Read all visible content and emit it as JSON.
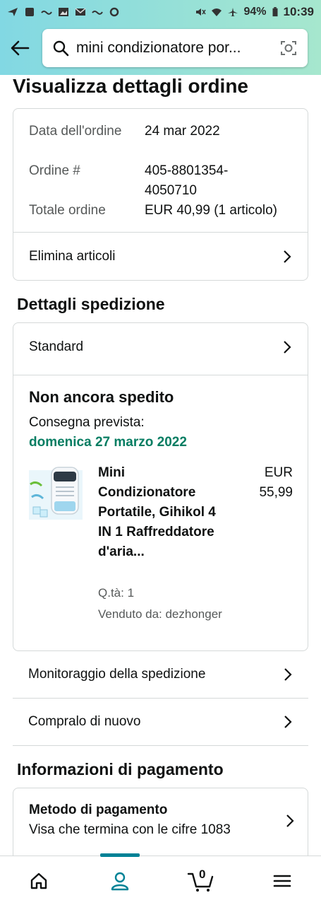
{
  "status_bar": {
    "battery": "94%",
    "time": "10:39"
  },
  "search": {
    "query": "mini condizionatore por..."
  },
  "page": {
    "title": "Visualizza dettagli ordine"
  },
  "order_summary": {
    "date_label": "Data dell'ordine",
    "date_value": "24 mar 2022",
    "order_label": "Ordine #",
    "order_value": "405-8801354-4050710",
    "total_label": "Totale ordine",
    "total_value": "EUR 40,99 (1 articolo)",
    "delete_items": "Elimina articoli"
  },
  "shipping": {
    "section_title": "Dettagli spedizione",
    "method": "Standard",
    "status": "Non ancora spedito",
    "expected_label": "Consegna prevista:",
    "expected_date": "domenica 27 marzo 2022",
    "product": {
      "title": "Mini Condizionatore Portatile, Gihikol 4 IN 1 Raffreddatore d'aria...",
      "price": "EUR 55,99",
      "qty": "Q.tà: 1",
      "seller": "Venduto da: dezhonger"
    }
  },
  "actions": {
    "track": "Monitoraggio della spedizione",
    "buy_again": "Compralo di nuovo"
  },
  "payment": {
    "section_title": "Informazioni di pagamento",
    "method_title": "Metodo di pagamento",
    "method_value": "Visa che termina con le cifre 1083"
  },
  "bottom_nav": {
    "cart_count": "0",
    "items": [
      "home-icon",
      "account-icon",
      "cart-icon",
      "menu-icon"
    ]
  },
  "colors": {
    "accent": "#008296",
    "green": "#067d62",
    "header_start": "#82d8e3",
    "header_end": "#a6e7ce"
  }
}
